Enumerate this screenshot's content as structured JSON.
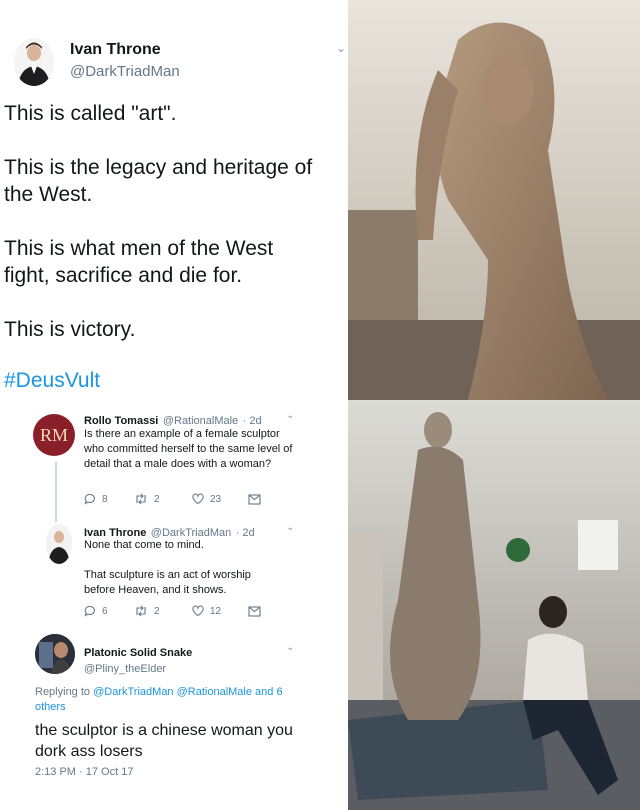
{
  "main_tweet": {
    "author_name": "Ivan Throne",
    "author_handle": "@DarkTriadMan",
    "paragraphs": [
      "This is called \"art\".",
      "This is the legacy and heritage of\nthe West.",
      "This is what men of the West\nfight, sacrifice and die for.",
      "This is victory."
    ],
    "hashtag": "#DeusVult"
  },
  "thread": [
    {
      "avatar_text": "RM",
      "author_name": "Rollo Tomassi",
      "author_handle": "@RationalMale",
      "age": "· 2d",
      "text": "Is there an example of a female sculptor who committed herself to the same level of detail that a male does with a woman?",
      "replies": "8",
      "retweets": "2",
      "likes": "23"
    },
    {
      "author_name": "Ivan Throne",
      "author_handle": "@DarkTriadMan",
      "age": "· 2d",
      "text1": "None that come to mind.",
      "text2": "That sculpture is an act of worship before Heaven, and it shows.",
      "replies": "6",
      "retweets": "2",
      "likes": "12"
    },
    {
      "author_name": "Platonic Solid Snake",
      "author_handle": "@Pliny_theElder",
      "replying_prefix": "Replying to",
      "replying_users": "@DarkTriadMan @RationalMale",
      "replying_suffix": "and 6 others",
      "text": "the sculptor is a chinese woman you dork ass losers",
      "timestamp": "2:13 PM · 17 Oct 17"
    }
  ],
  "icons": {
    "reply": "reply-icon",
    "retweet": "retweet-icon",
    "like": "heart-icon",
    "dm": "mail-icon",
    "chevron": "chevron-down-icon"
  },
  "colors": {
    "link": "#1b95e0",
    "muted": "#657786",
    "text": "#14171a"
  }
}
